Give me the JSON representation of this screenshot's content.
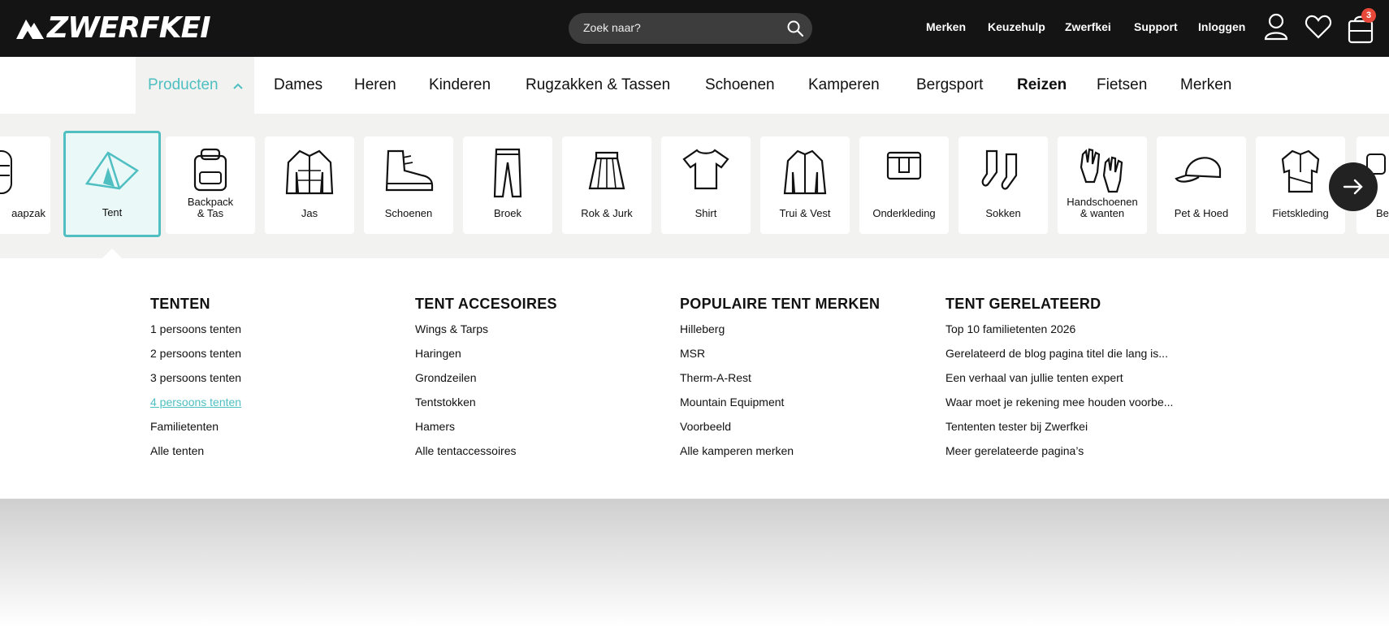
{
  "header": {
    "brand": "ZWERFKEI",
    "search_placeholder": "Zoek naar?",
    "links": [
      "Merken",
      "Keuzehulp",
      "Zwerfkei",
      "Support",
      "Inloggen"
    ],
    "cart_count": "3",
    "icons": [
      "user-icon",
      "heart-icon",
      "cart-icon",
      "search-icon"
    ]
  },
  "categories": [
    "Producten",
    "Dames",
    "Heren",
    "Kinderen",
    "Rugzakken & Tassen",
    "Schoenen",
    "Kamperen",
    "Bergsport",
    "Reizen",
    "Fietsen",
    "Merken"
  ],
  "tiles": [
    {
      "label": "aapzak",
      "icon": "sleeping-bag-icon"
    },
    {
      "label": "Tent",
      "icon": "tent-icon",
      "selected": true
    },
    {
      "label": "Backpack & Tas",
      "icon": "backpack-icon"
    },
    {
      "label": "Jas",
      "icon": "jacket-icon"
    },
    {
      "label": "Schoenen",
      "icon": "boot-icon"
    },
    {
      "label": "Broek",
      "icon": "trousers-icon"
    },
    {
      "label": "Rok & Jurk",
      "icon": "skirt-icon"
    },
    {
      "label": "Shirt",
      "icon": "shirt-icon"
    },
    {
      "label": "Trui & Vest",
      "icon": "fleece-icon"
    },
    {
      "label": "Onderkleding",
      "icon": "underwear-icon"
    },
    {
      "label": "Sokken",
      "icon": "socks-icon"
    },
    {
      "label": "Handschoenen & wanten",
      "icon": "gloves-icon"
    },
    {
      "label": "Pet & Hoed",
      "icon": "cap-icon"
    },
    {
      "label": "Fietskleding",
      "icon": "cycling-jersey-icon"
    },
    {
      "label": "Be",
      "icon": "partial-icon"
    }
  ],
  "menu": {
    "col1": {
      "title": "TENTEN",
      "items": [
        "1 persoons tenten",
        "2 persoons tenten",
        "3 persoons tenten",
        "4 persoons tenten",
        "Familietenten",
        "Alle tenten"
      ]
    },
    "col2": {
      "title": "TENT ACCESOIRES",
      "items": [
        "Wings & Tarps",
        "Haringen",
        "Grondzeilen",
        "Tentstokken",
        "Hamers",
        "Alle tentaccessoires"
      ]
    },
    "col3": {
      "title": "POPULAIRE TENT MERKEN",
      "items": [
        "Hilleberg",
        "MSR",
        "Therm-A-Rest",
        "Mountain Equipment",
        "Voorbeeld",
        "Alle kamperen merken"
      ]
    },
    "col4": {
      "title": "TENT GERELATEERD",
      "items": [
        "Top 10 familietenten 2026",
        "Gerelateerd de blog pagina titel die lang is...",
        "Een verhaal van jullie tenten expert",
        "Waar moet je rekening mee houden voorbe...",
        "Tententen tester bij Zwerfkei",
        "Meer gerelateerde pagina’s"
      ]
    }
  },
  "colors": {
    "accent": "#4fbfc1",
    "topbar": "#141414",
    "badge": "#e8483a"
  }
}
